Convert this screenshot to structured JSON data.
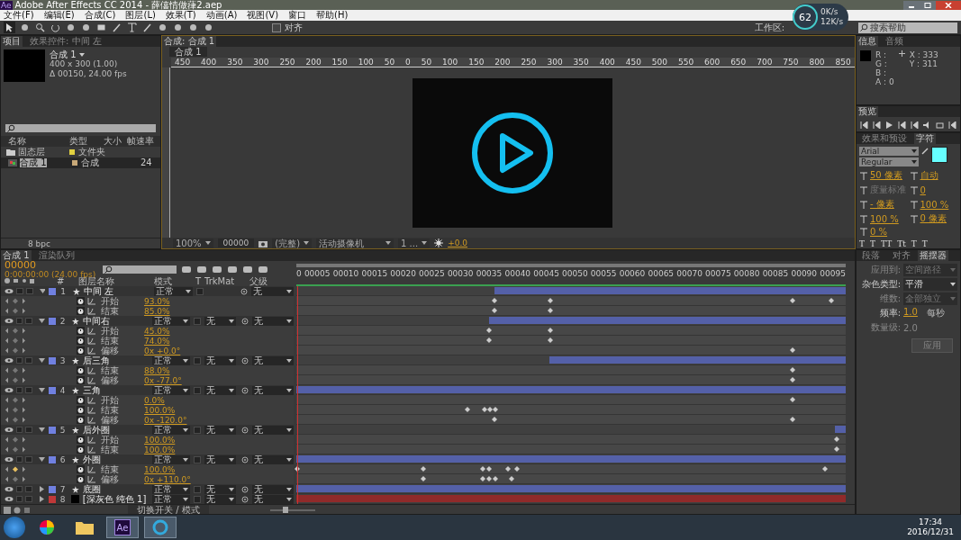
{
  "window": {
    "logo": "Ae",
    "title": "Adobe After Effects CC 2014 - 薛僖情做葎2.aep"
  },
  "menu": [
    "文件(F)",
    "编辑(E)",
    "合成(C)",
    "图层(L)",
    "效果(T)",
    "动画(A)",
    "视图(V)",
    "窗口",
    "帮助(H)"
  ],
  "toolbar": {
    "snap_label": "对齐",
    "snap_checked": false,
    "workspace_label": "工作区:",
    "search_placeholder": "搜索帮助"
  },
  "net_widget": {
    "percent": "62",
    "up": "0K/s",
    "down": "12K/s"
  },
  "project": {
    "tabs": [
      {
        "label": "项目",
        "selected": true
      },
      {
        "label": "效果控件: 中间 左",
        "selected": false
      }
    ],
    "comp_name": "合成 1",
    "comp_size": "400 x 300 (1.00)",
    "comp_duration": "Δ 00150, 24.00 fps",
    "columns": [
      "名称",
      "类型",
      "大小",
      "帧速率"
    ],
    "items": [
      {
        "kind": "folder",
        "name": "固态层",
        "color": "#e0d040",
        "type": "文件夹",
        "selected": false
      },
      {
        "kind": "comp",
        "name": "合成 1",
        "color": "#c8a878",
        "type": "合成",
        "fps": "24",
        "selected": true
      }
    ],
    "bpc": "8 bpc"
  },
  "viewer": {
    "tab": "合成: 合成 1",
    "subtab": "合成 1",
    "ruler": [
      "450",
      "400",
      "350",
      "300",
      "250",
      "200",
      "150",
      "100",
      "50",
      "0",
      "50",
      "100",
      "150",
      "200",
      "250",
      "300",
      "350",
      "400",
      "450",
      "500",
      "550",
      "600",
      "650",
      "700",
      "750",
      "800",
      "850"
    ],
    "zoom": "100%",
    "timecode": "00000",
    "resolution": "(完整)",
    "camera": "活动摄像机",
    "views": "1 ...",
    "exposure": "+0.0"
  },
  "info": {
    "tabs": [
      {
        "label": "信息",
        "selected": true
      },
      {
        "label": "音频",
        "selected": false
      }
    ],
    "channels": [
      "R :",
      "G :",
      "B :",
      "A : 0"
    ],
    "coords": [
      "X : 333",
      "Y : 311"
    ]
  },
  "preview": {
    "tabs": [
      {
        "label": "预览",
        "selected": true
      }
    ]
  },
  "character": {
    "tabs": [
      {
        "label": "效果和预设",
        "selected": false
      },
      {
        "label": "字符",
        "selected": true
      }
    ],
    "font": "Arial",
    "style": "Regular",
    "fields": [
      {
        "value": "50 像素",
        "dim": false
      },
      {
        "value": "自动",
        "dim": false
      },
      {
        "value": "度量标准",
        "dim": true
      },
      {
        "value": "0",
        "dim": false
      },
      {
        "value": "- 像素",
        "dim": false
      },
      {
        "value": "100 %",
        "dim": false
      },
      {
        "value": "100 %",
        "dim": false
      },
      {
        "value": "0 像素",
        "dim": false
      },
      {
        "value": "0 %",
        "dim": false
      }
    ],
    "styles": [
      "T",
      "T",
      "TT",
      "Tt",
      "T",
      "T"
    ]
  },
  "wiggler": {
    "tabs": [
      {
        "label": "段落",
        "selected": false
      },
      {
        "label": "对齐",
        "selected": false
      },
      {
        "label": "摇摆器",
        "selected": true
      }
    ],
    "rows": [
      {
        "label": "应用到:",
        "value": "空间路径",
        "kind": "select",
        "disabled": true
      },
      {
        "label": "杂色类型:",
        "value": "平滑",
        "kind": "select",
        "disabled": false
      },
      {
        "label": "维数:",
        "value": "全部独立",
        "kind": "select",
        "disabled": true
      },
      {
        "label": "频率:",
        "value": "1.0",
        "unit": "每秒",
        "kind": "number",
        "disabled": false
      },
      {
        "label": "数量级:",
        "value": "2.0",
        "kind": "number",
        "disabled": true
      }
    ],
    "apply": "应用"
  },
  "timeline": {
    "tabs": [
      {
        "label": "合成 1",
        "selected": true
      },
      {
        "label": "渲染队列",
        "selected": false
      }
    ],
    "timecode": "00000",
    "timecode_sub": "0:00:00:00 (24.00 fps)",
    "columns": [
      "#",
      "图层名称",
      "模式",
      "T",
      "TrkMat",
      "父级"
    ],
    "ruler": [
      "0",
      "00005",
      "00010",
      "00015",
      "00020",
      "00025",
      "00030",
      "00035",
      "00040",
      "00045",
      "00050",
      "00055",
      "00060",
      "00065",
      "00070",
      "00075",
      "00080",
      "00085",
      "00090",
      "00095"
    ],
    "layers": [
      {
        "num": "1",
        "name": "中间 左",
        "kind": "shape",
        "color": "#7080e0",
        "mode": "正常",
        "preserve_transparency": false,
        "parent": "无",
        "expanded": true,
        "bar": {
          "level": 0.64
        },
        "props": [
          {
            "name": "开始",
            "value": "93.0%"
          },
          {
            "name": "结束",
            "value": "85.0%"
          }
        ]
      },
      {
        "num": "2",
        "name": "中间右",
        "kind": "shape",
        "color": "#7080e0",
        "mode": "正常",
        "preserve_transparency": false,
        "trkmat": "无",
        "parent": "无",
        "expanded": true,
        "bar": {
          "level": 0.65
        },
        "props": [
          {
            "name": "开始",
            "value": "45.0%"
          },
          {
            "name": "结束",
            "value": "74.0%"
          },
          {
            "name": "偏移",
            "value": "0x +0.0°"
          }
        ]
      },
      {
        "num": "3",
        "name": "后三角",
        "kind": "shape",
        "color": "#7080e0",
        "mode": "正常",
        "preserve_transparency": false,
        "trkmat": "无",
        "parent": "无",
        "expanded": true,
        "bar": {
          "level": 0.54
        },
        "props": [
          {
            "name": "结束",
            "value": "88.0%"
          },
          {
            "name": "偏移",
            "value": "0x -77.0°"
          }
        ]
      },
      {
        "num": "4",
        "name": "三角",
        "kind": "shape",
        "color": "#7080e0",
        "mode": "正常",
        "preserve_transparency": false,
        "trkmat": "无",
        "parent": "无",
        "expanded": true,
        "bar": {
          "level": 1
        },
        "props": [
          {
            "name": "开始",
            "value": "0.0%"
          },
          {
            "name": "结束",
            "value": "100.0%"
          },
          {
            "name": "偏移",
            "value": "0x -120.0°"
          }
        ]
      },
      {
        "num": "5",
        "name": "后外圈",
        "kind": "shape",
        "color": "#7080e0",
        "mode": "正常",
        "preserve_transparency": false,
        "trkmat": "无",
        "parent": "无",
        "expanded": true,
        "bar": {
          "level": 0.02
        },
        "props": [
          {
            "name": "开始",
            "value": "100.0%"
          },
          {
            "name": "结束",
            "value": "100.0%"
          }
        ]
      },
      {
        "num": "6",
        "name": "外圈",
        "kind": "shape",
        "color": "#7080e0",
        "mode": "正常",
        "preserve_transparency": false,
        "trkmat": "无",
        "parent": "无",
        "expanded": true,
        "bar": {
          "level": 1
        },
        "props": [
          {
            "name": "结束",
            "value": "100.0%"
          },
          {
            "name": "偏移",
            "value": "0x +110.0°"
          }
        ]
      },
      {
        "num": "7",
        "name": "底圈",
        "kind": "shape",
        "color": "#7080e0",
        "mode": "正常",
        "preserve_transparency": false,
        "trkmat": "无",
        "parent": "无",
        "expanded": false,
        "bar": {
          "level": 1
        }
      },
      {
        "num": "8",
        "name": "[深灰色 纯色 1]",
        "kind": "solid",
        "color": "#c03838",
        "mode": "正常",
        "preserve_transparency": false,
        "trkmat": "无",
        "parent": "无",
        "expanded": false,
        "bar": {
          "level": 1
        }
      }
    ],
    "footer": "切换开关 / 模式",
    "zoom": {
      "level": 0.35
    }
  },
  "taskbar": {
    "ae_label": "Ae",
    "time": "17:34",
    "date": "2016/12/31"
  }
}
